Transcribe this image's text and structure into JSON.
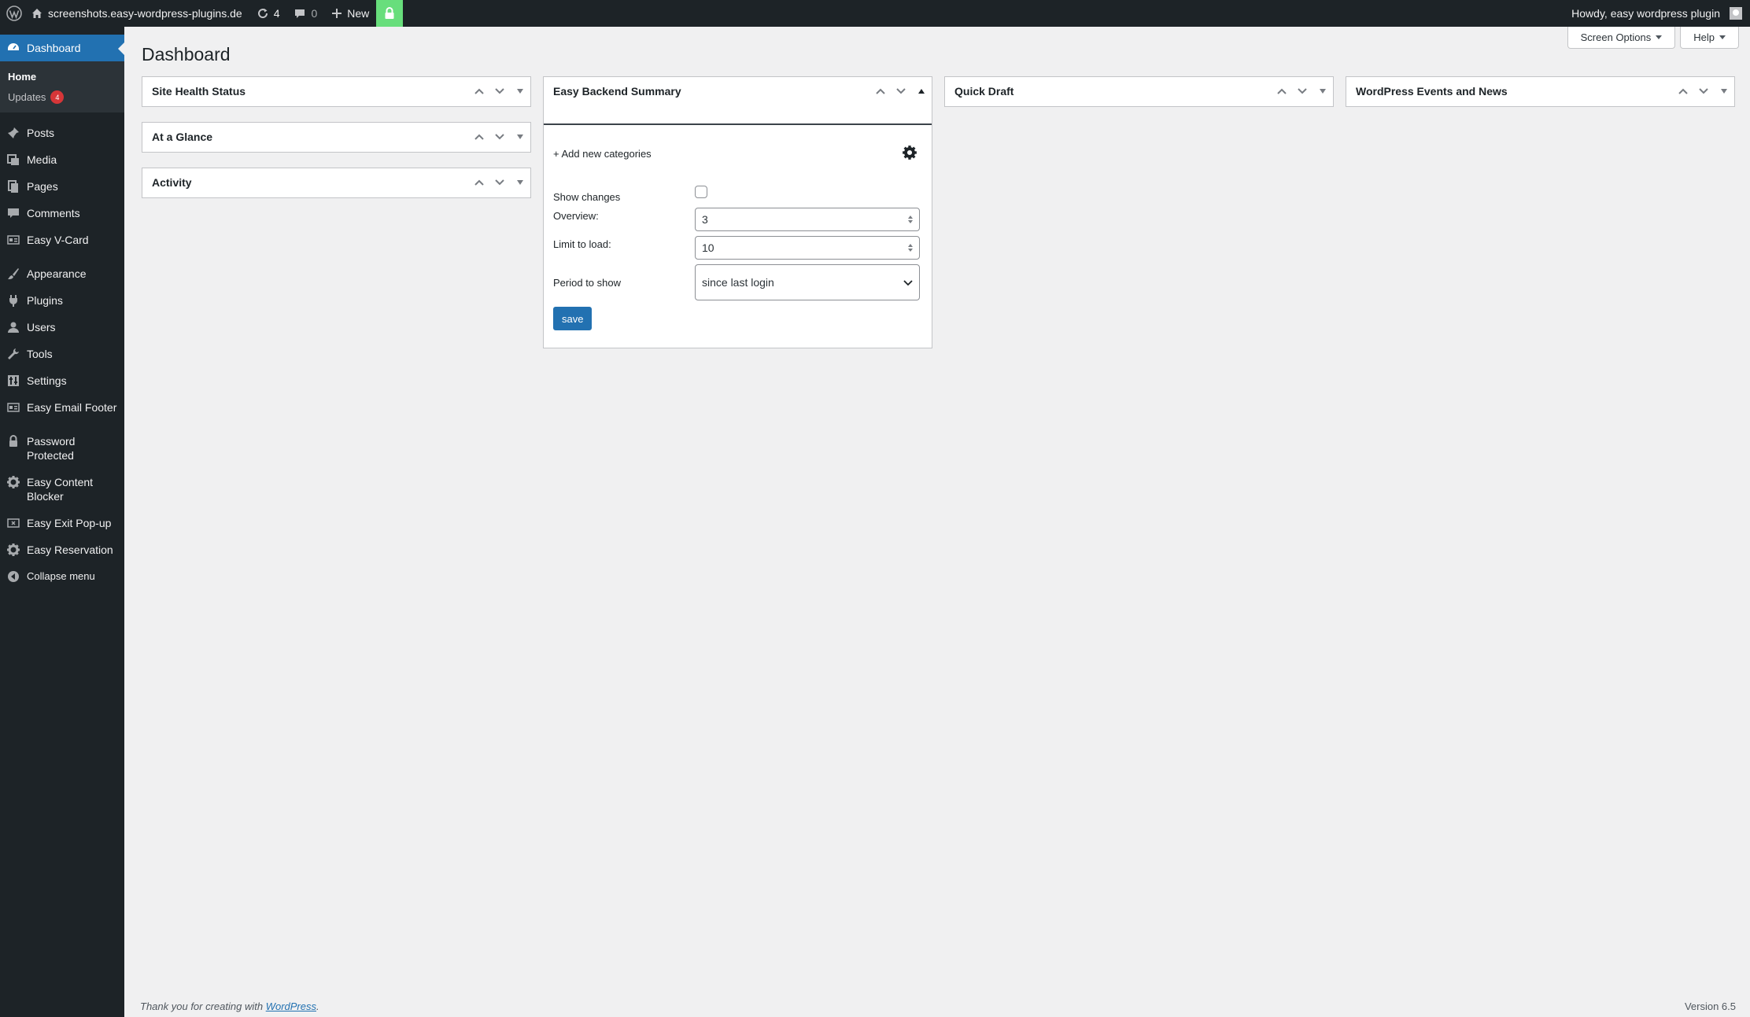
{
  "adminbar": {
    "site_name": "screenshots.easy-wordpress-plugins.de",
    "updates_count": "4",
    "comments_count": "0",
    "new_label": "New",
    "howdy": "Howdy, easy wordpress plugin"
  },
  "sidebar": {
    "dashboard": "Dashboard",
    "sub_home": "Home",
    "sub_updates": "Updates",
    "sub_updates_badge": "4",
    "items": [
      {
        "label": "Posts",
        "icon": "pin-icon"
      },
      {
        "label": "Media",
        "icon": "media-icon"
      },
      {
        "label": "Pages",
        "icon": "pages-icon"
      },
      {
        "label": "Comments",
        "icon": "comment-icon"
      },
      {
        "label": "Easy V-Card",
        "icon": "id-card-icon"
      },
      {
        "label": "Appearance",
        "icon": "brush-icon"
      },
      {
        "label": "Plugins",
        "icon": "plug-icon"
      },
      {
        "label": "Users",
        "icon": "users-icon"
      },
      {
        "label": "Tools",
        "icon": "wrench-icon"
      },
      {
        "label": "Settings",
        "icon": "settings-icon"
      },
      {
        "label": "Easy Email Footer",
        "icon": "id-card-icon"
      },
      {
        "label": "Password Protected",
        "icon": "lock-icon"
      },
      {
        "label": "Easy Content Blocker",
        "icon": "gear-icon"
      },
      {
        "label": "Easy Exit Pop-up",
        "icon": "popup-icon"
      },
      {
        "label": "Easy Reservation",
        "icon": "gear-icon"
      }
    ],
    "collapse": "Collapse menu"
  },
  "header": {
    "title": "Dashboard",
    "screen_options": "Screen Options",
    "help": "Help"
  },
  "widgets": {
    "site_health": "Site Health Status",
    "at_a_glance": "At a Glance",
    "activity": "Activity",
    "easy_backend_summary": "Easy Backend Summary",
    "quick_draft": "Quick Draft",
    "events_news": "WordPress Events and News"
  },
  "ebs": {
    "add_categories": "+ Add new categories",
    "show_changes_label": "Show changes",
    "overview_label": "Overview:",
    "overview_value": "3",
    "limit_label": "Limit to load:",
    "limit_value": "10",
    "period_label": "Period to show",
    "period_value": "since last login",
    "save_label": "save"
  },
  "footer": {
    "thanks_prefix": "Thank you for creating with ",
    "thanks_link": "WordPress",
    "thanks_suffix": ".",
    "version": "Version 6.5"
  },
  "colors": {
    "admin_bg": "#1d2327",
    "accent": "#2271b1",
    "badge": "#d63638",
    "lock_green": "#68de7c"
  }
}
